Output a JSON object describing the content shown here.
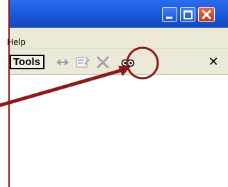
{
  "menubar": {
    "help_label": "Help"
  },
  "toolbar": {
    "tools_label": "Tools",
    "close_symbol": "✕",
    "icons": [
      "move-icon",
      "properties-icon",
      "delete-icon",
      "view-glasses-icon"
    ]
  },
  "colors": {
    "titlebar": "#1a56d8",
    "annotation": "#8b1a1a",
    "close_button": "#c33a1d"
  }
}
